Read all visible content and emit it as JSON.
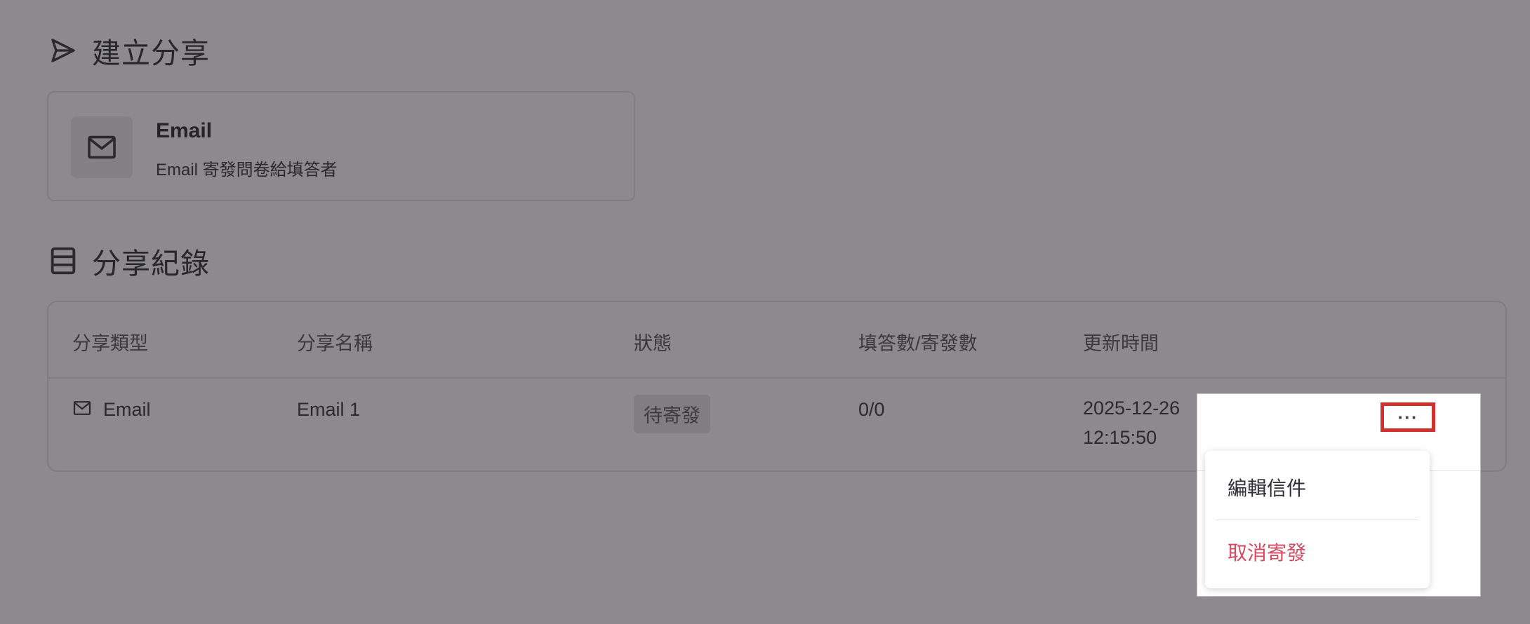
{
  "create_share": {
    "title": "建立分享",
    "email_card": {
      "title": "Email",
      "description": "Email 寄發問卷給填答者",
      "icon": "mail-icon"
    }
  },
  "share_records": {
    "title": "分享紀錄",
    "columns": [
      "分享類型",
      "分享名稱",
      "狀態",
      "填答數/寄發數",
      "更新時間"
    ],
    "rows": [
      {
        "type": "Email",
        "name": "Email 1",
        "status": "待寄發",
        "counts": "0/0",
        "updated_date": "2025-12-26",
        "updated_time": "12:15:50"
      }
    ]
  },
  "actions": {
    "more_label": "···",
    "menu": [
      {
        "label": "編輯信件",
        "color": "#2f2f33"
      },
      {
        "label": "取消寄發",
        "color": "#d64a5f"
      }
    ]
  },
  "colors": {
    "overlay_bg": "#8c8a8e",
    "highlight": "#d0312d",
    "danger": "#d64a5f"
  }
}
